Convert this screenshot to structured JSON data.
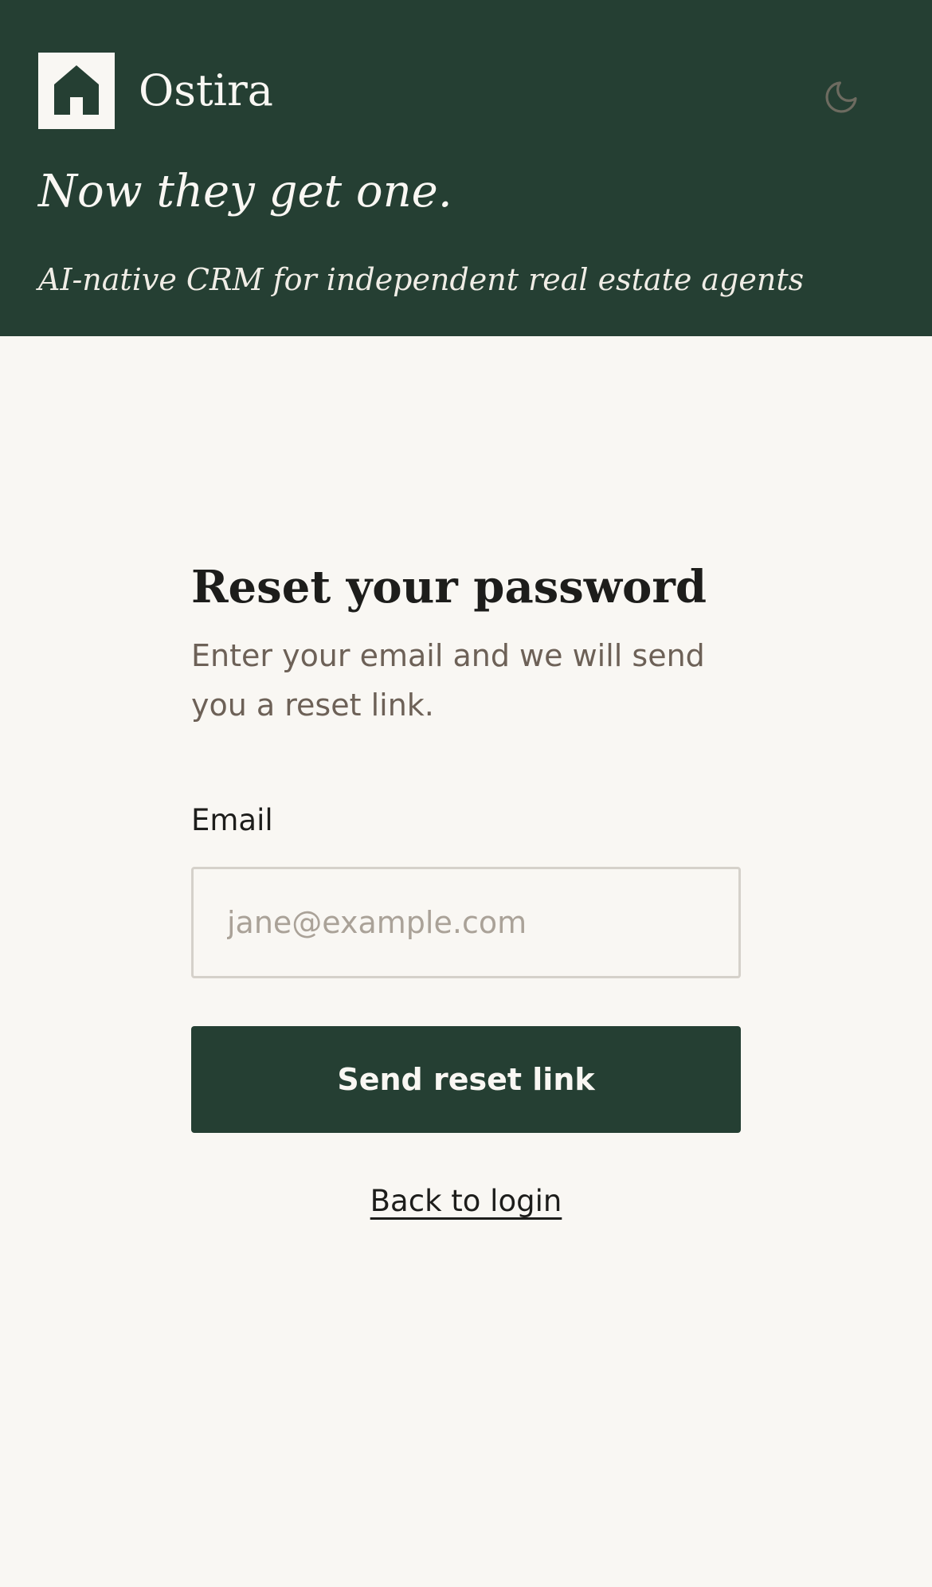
{
  "header": {
    "brand": "Ostira",
    "logo_icon": "house-icon",
    "theme_toggle_icon": "moon-icon",
    "tagline": "Now they get one.",
    "subtagline": "AI-native CRM for independent real estate agents"
  },
  "form": {
    "title": "Reset your password",
    "description": "Enter your email and we will send you a reset link.",
    "email_label": "Email",
    "email_value": "",
    "email_placeholder": "jane@example.com",
    "submit_label": "Send reset link",
    "back_label": "Back to login"
  },
  "colors": {
    "primary": "#253f33",
    "background": "#f9f7f3",
    "text": "#1d1d1b",
    "muted": "#6d6157",
    "placeholder": "#aaa298",
    "border": "#d5d1ca"
  }
}
